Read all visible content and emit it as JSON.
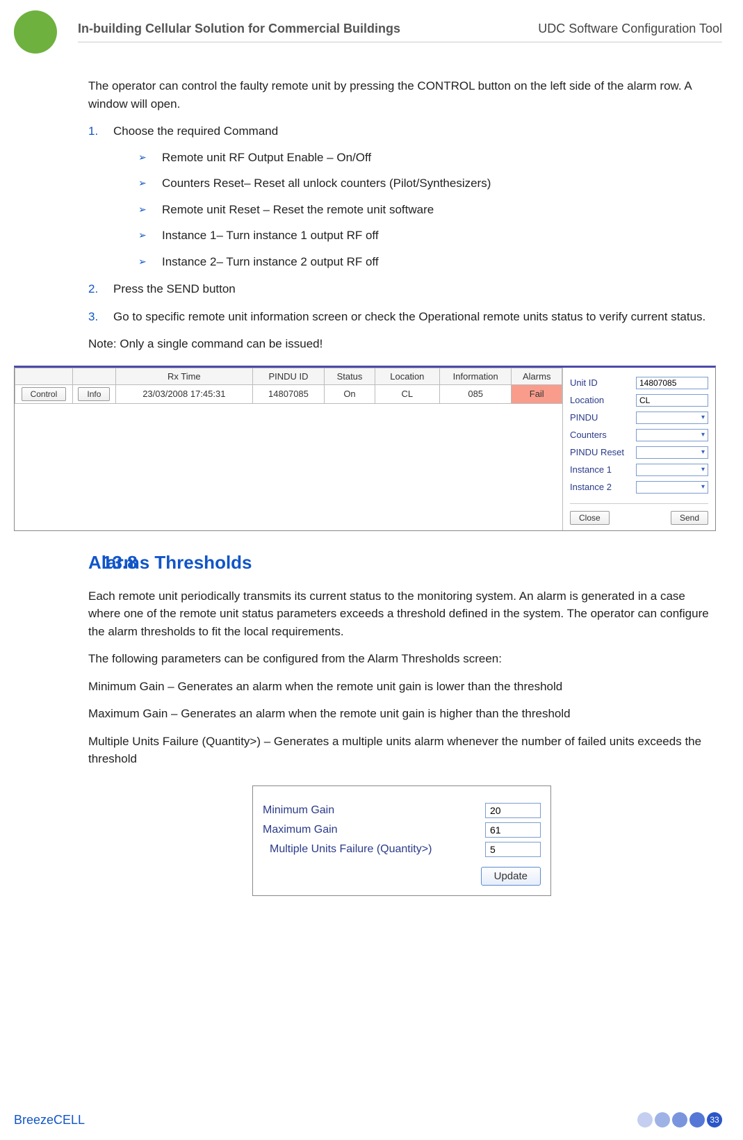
{
  "header": {
    "left": "In-building Cellular Solution for Commercial Buildings",
    "right": "UDC Software Configuration Tool"
  },
  "intro": "The operator can control the faulty remote unit by pressing the CONTROL button on the left side of the alarm row. A window will open.",
  "steps": {
    "s1_num": "1.",
    "s1": "Choose the required Command",
    "bullets": [
      "Remote unit RF Output Enable – On/Off",
      "Counters Reset– Reset all unlock counters (Pilot/Synthesizers)",
      "Remote unit Reset – Reset the remote unit software",
      "Instance 1– Turn instance 1 output RF off",
      "Instance 2– Turn instance 2 output RF off"
    ],
    "s2_num": "2.",
    "s2": "Press the SEND button",
    "s3_num": "3.",
    "s3": "Go to specific remote unit information screen or check the Operational remote units status to verify current status."
  },
  "note": "Note: Only a single command can be issued!",
  "grid": {
    "headers": [
      "",
      "",
      "Rx Time",
      "PINDU ID",
      "Status",
      "Location",
      "Information",
      "Alarms"
    ],
    "control_btn": "Control",
    "info_btn": "Info",
    "row": {
      "rx_time": "23/03/2008 17:45:31",
      "pindu": "14807085",
      "status": "On",
      "location": "CL",
      "info": "085",
      "alarms": "Fail"
    }
  },
  "panel": {
    "labels": {
      "unit_id": "Unit ID",
      "location": "Location",
      "pindu": "PINDU",
      "counters": "Counters",
      "pindu_reset": "PINDU Reset",
      "inst1": "Instance 1",
      "inst2": "Instance 2"
    },
    "values": {
      "unit_id": "14807085",
      "location": "CL"
    },
    "close": "Close",
    "send": "Send"
  },
  "section": {
    "num": "13.8",
    "title": "Alarms Thresholds"
  },
  "p1": "Each remote unit periodically transmits its current status to the monitoring system. An alarm is generated in a case where one of the remote unit status parameters exceeds a threshold defined in the system. The operator can configure the alarm thresholds to fit the local requirements.",
  "p2": "The following parameters can be configured from the Alarm Thresholds screen:",
  "p3": "Minimum Gain – Generates an alarm when the remote unit gain is lower than the threshold",
  "p4": "Maximum Gain – Generates an alarm when the remote unit gain is higher than the threshold",
  "p5": "Multiple Units Failure (Quantity>) – Generates a multiple units alarm whenever the number of failed units exceeds the threshold",
  "thresholds": {
    "min_label": "Minimum Gain",
    "min_val": "20",
    "max_label": "Maximum Gain",
    "max_val": "61",
    "multi_label": "Multiple Units Failure (Quantity>)",
    "multi_val": "5",
    "update": "Update"
  },
  "footer": {
    "brand": "BreezeCELL",
    "page": "33"
  }
}
